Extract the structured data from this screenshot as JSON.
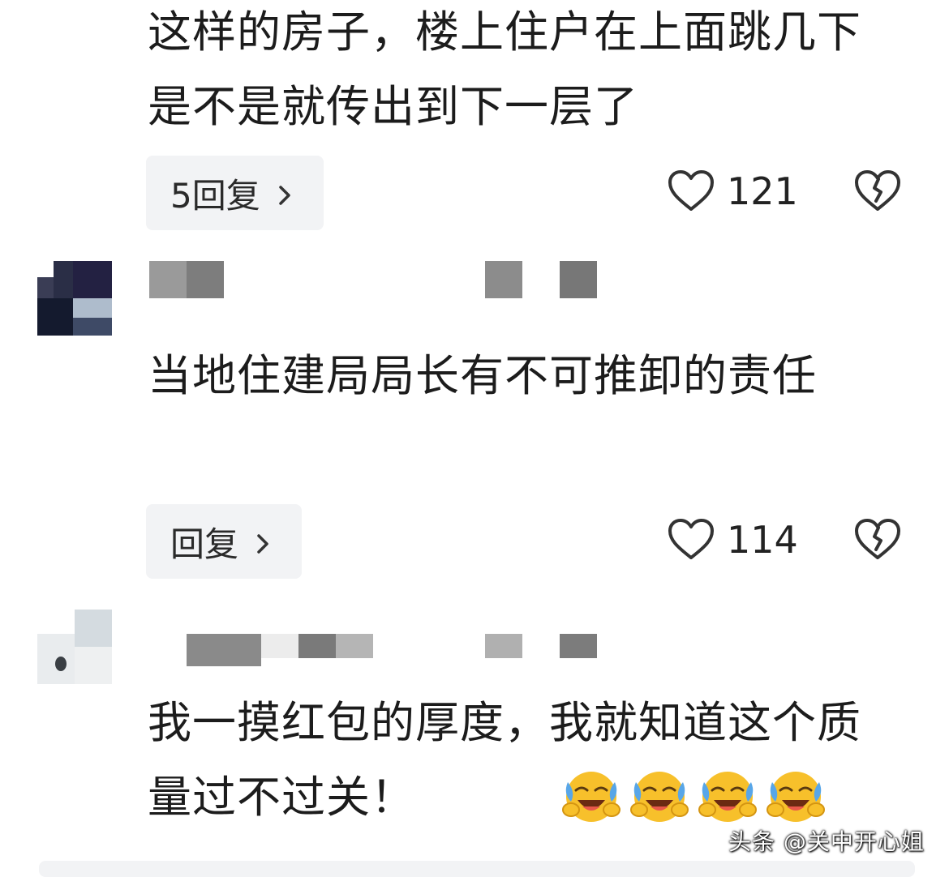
{
  "comments": [
    {
      "text": "这样的房子，楼上住户在上面跳几下是不是就传出到下一层了",
      "reply_label": "5回复",
      "like_count": "121"
    },
    {
      "text": "当地住建局局长有不可推卸的责任",
      "reply_label": "回复",
      "like_count": "114"
    },
    {
      "text": "我一摸红包的厚度，我就知道这个质量过不过关！",
      "emoji_names": [
        "rolling-laughing-emoji",
        "rolling-laughing-emoji",
        "rolling-laughing-emoji",
        "rolling-laughing-emoji"
      ]
    }
  ],
  "icons": {
    "like": "heart-outline-icon",
    "dislike": "broken-heart-icon",
    "reply_chevron": "chevron-right-icon"
  },
  "watermark": "头条 @关中开心姐",
  "colors": {
    "reply_bg": "#f2f3f5",
    "text": "#1c1c1c",
    "icon": "#333333"
  }
}
